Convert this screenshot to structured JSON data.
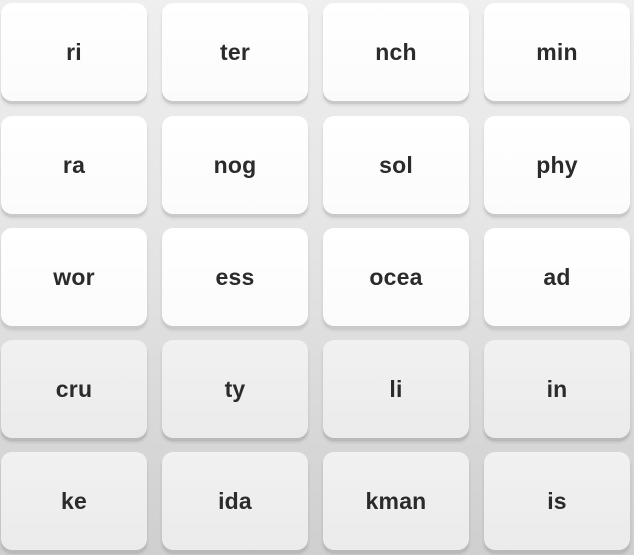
{
  "tiles": [
    [
      "ri",
      "ter",
      "nch",
      "min"
    ],
    [
      "ra",
      "nog",
      "sol",
      "phy"
    ],
    [
      "wor",
      "ess",
      "ocea",
      "ad"
    ],
    [
      "cru",
      "ty",
      "li",
      "in"
    ],
    [
      "ke",
      "ida",
      "kman",
      "is"
    ]
  ]
}
